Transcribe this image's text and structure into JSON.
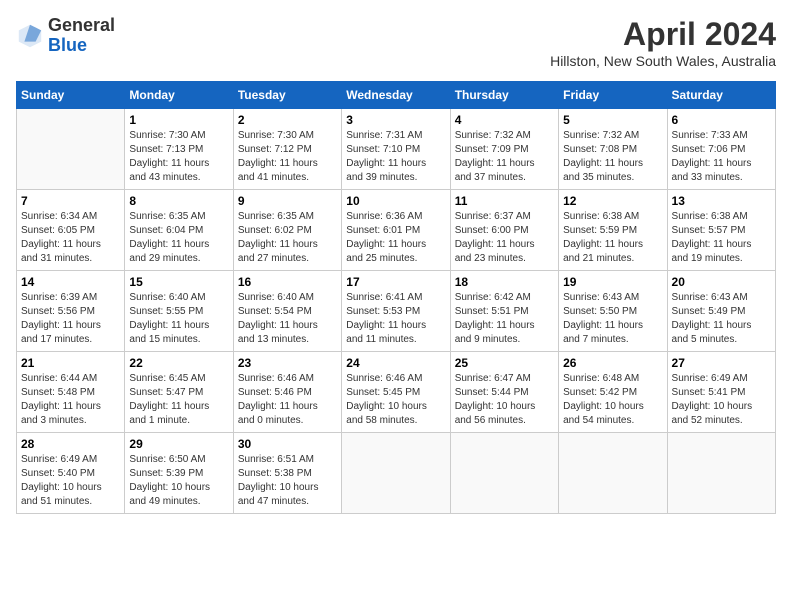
{
  "header": {
    "title": "April 2024",
    "location": "Hillston, New South Wales, Australia",
    "logo_general": "General",
    "logo_blue": "Blue"
  },
  "days_of_week": [
    "Sunday",
    "Monday",
    "Tuesday",
    "Wednesday",
    "Thursday",
    "Friday",
    "Saturday"
  ],
  "weeks": [
    [
      {
        "day": "",
        "info": ""
      },
      {
        "day": "1",
        "info": "Sunrise: 7:30 AM\nSunset: 7:13 PM\nDaylight: 11 hours\nand 43 minutes."
      },
      {
        "day": "2",
        "info": "Sunrise: 7:30 AM\nSunset: 7:12 PM\nDaylight: 11 hours\nand 41 minutes."
      },
      {
        "day": "3",
        "info": "Sunrise: 7:31 AM\nSunset: 7:10 PM\nDaylight: 11 hours\nand 39 minutes."
      },
      {
        "day": "4",
        "info": "Sunrise: 7:32 AM\nSunset: 7:09 PM\nDaylight: 11 hours\nand 37 minutes."
      },
      {
        "day": "5",
        "info": "Sunrise: 7:32 AM\nSunset: 7:08 PM\nDaylight: 11 hours\nand 35 minutes."
      },
      {
        "day": "6",
        "info": "Sunrise: 7:33 AM\nSunset: 7:06 PM\nDaylight: 11 hours\nand 33 minutes."
      }
    ],
    [
      {
        "day": "7",
        "info": "Sunrise: 6:34 AM\nSunset: 6:05 PM\nDaylight: 11 hours\nand 31 minutes."
      },
      {
        "day": "8",
        "info": "Sunrise: 6:35 AM\nSunset: 6:04 PM\nDaylight: 11 hours\nand 29 minutes."
      },
      {
        "day": "9",
        "info": "Sunrise: 6:35 AM\nSunset: 6:02 PM\nDaylight: 11 hours\nand 27 minutes."
      },
      {
        "day": "10",
        "info": "Sunrise: 6:36 AM\nSunset: 6:01 PM\nDaylight: 11 hours\nand 25 minutes."
      },
      {
        "day": "11",
        "info": "Sunrise: 6:37 AM\nSunset: 6:00 PM\nDaylight: 11 hours\nand 23 minutes."
      },
      {
        "day": "12",
        "info": "Sunrise: 6:38 AM\nSunset: 5:59 PM\nDaylight: 11 hours\nand 21 minutes."
      },
      {
        "day": "13",
        "info": "Sunrise: 6:38 AM\nSunset: 5:57 PM\nDaylight: 11 hours\nand 19 minutes."
      }
    ],
    [
      {
        "day": "14",
        "info": "Sunrise: 6:39 AM\nSunset: 5:56 PM\nDaylight: 11 hours\nand 17 minutes."
      },
      {
        "day": "15",
        "info": "Sunrise: 6:40 AM\nSunset: 5:55 PM\nDaylight: 11 hours\nand 15 minutes."
      },
      {
        "day": "16",
        "info": "Sunrise: 6:40 AM\nSunset: 5:54 PM\nDaylight: 11 hours\nand 13 minutes."
      },
      {
        "day": "17",
        "info": "Sunrise: 6:41 AM\nSunset: 5:53 PM\nDaylight: 11 hours\nand 11 minutes."
      },
      {
        "day": "18",
        "info": "Sunrise: 6:42 AM\nSunset: 5:51 PM\nDaylight: 11 hours\nand 9 minutes."
      },
      {
        "day": "19",
        "info": "Sunrise: 6:43 AM\nSunset: 5:50 PM\nDaylight: 11 hours\nand 7 minutes."
      },
      {
        "day": "20",
        "info": "Sunrise: 6:43 AM\nSunset: 5:49 PM\nDaylight: 11 hours\nand 5 minutes."
      }
    ],
    [
      {
        "day": "21",
        "info": "Sunrise: 6:44 AM\nSunset: 5:48 PM\nDaylight: 11 hours\nand 3 minutes."
      },
      {
        "day": "22",
        "info": "Sunrise: 6:45 AM\nSunset: 5:47 PM\nDaylight: 11 hours\nand 1 minute."
      },
      {
        "day": "23",
        "info": "Sunrise: 6:46 AM\nSunset: 5:46 PM\nDaylight: 11 hours\nand 0 minutes."
      },
      {
        "day": "24",
        "info": "Sunrise: 6:46 AM\nSunset: 5:45 PM\nDaylight: 10 hours\nand 58 minutes."
      },
      {
        "day": "25",
        "info": "Sunrise: 6:47 AM\nSunset: 5:44 PM\nDaylight: 10 hours\nand 56 minutes."
      },
      {
        "day": "26",
        "info": "Sunrise: 6:48 AM\nSunset: 5:42 PM\nDaylight: 10 hours\nand 54 minutes."
      },
      {
        "day": "27",
        "info": "Sunrise: 6:49 AM\nSunset: 5:41 PM\nDaylight: 10 hours\nand 52 minutes."
      }
    ],
    [
      {
        "day": "28",
        "info": "Sunrise: 6:49 AM\nSunset: 5:40 PM\nDaylight: 10 hours\nand 51 minutes."
      },
      {
        "day": "29",
        "info": "Sunrise: 6:50 AM\nSunset: 5:39 PM\nDaylight: 10 hours\nand 49 minutes."
      },
      {
        "day": "30",
        "info": "Sunrise: 6:51 AM\nSunset: 5:38 PM\nDaylight: 10 hours\nand 47 minutes."
      },
      {
        "day": "",
        "info": ""
      },
      {
        "day": "",
        "info": ""
      },
      {
        "day": "",
        "info": ""
      },
      {
        "day": "",
        "info": ""
      }
    ]
  ]
}
